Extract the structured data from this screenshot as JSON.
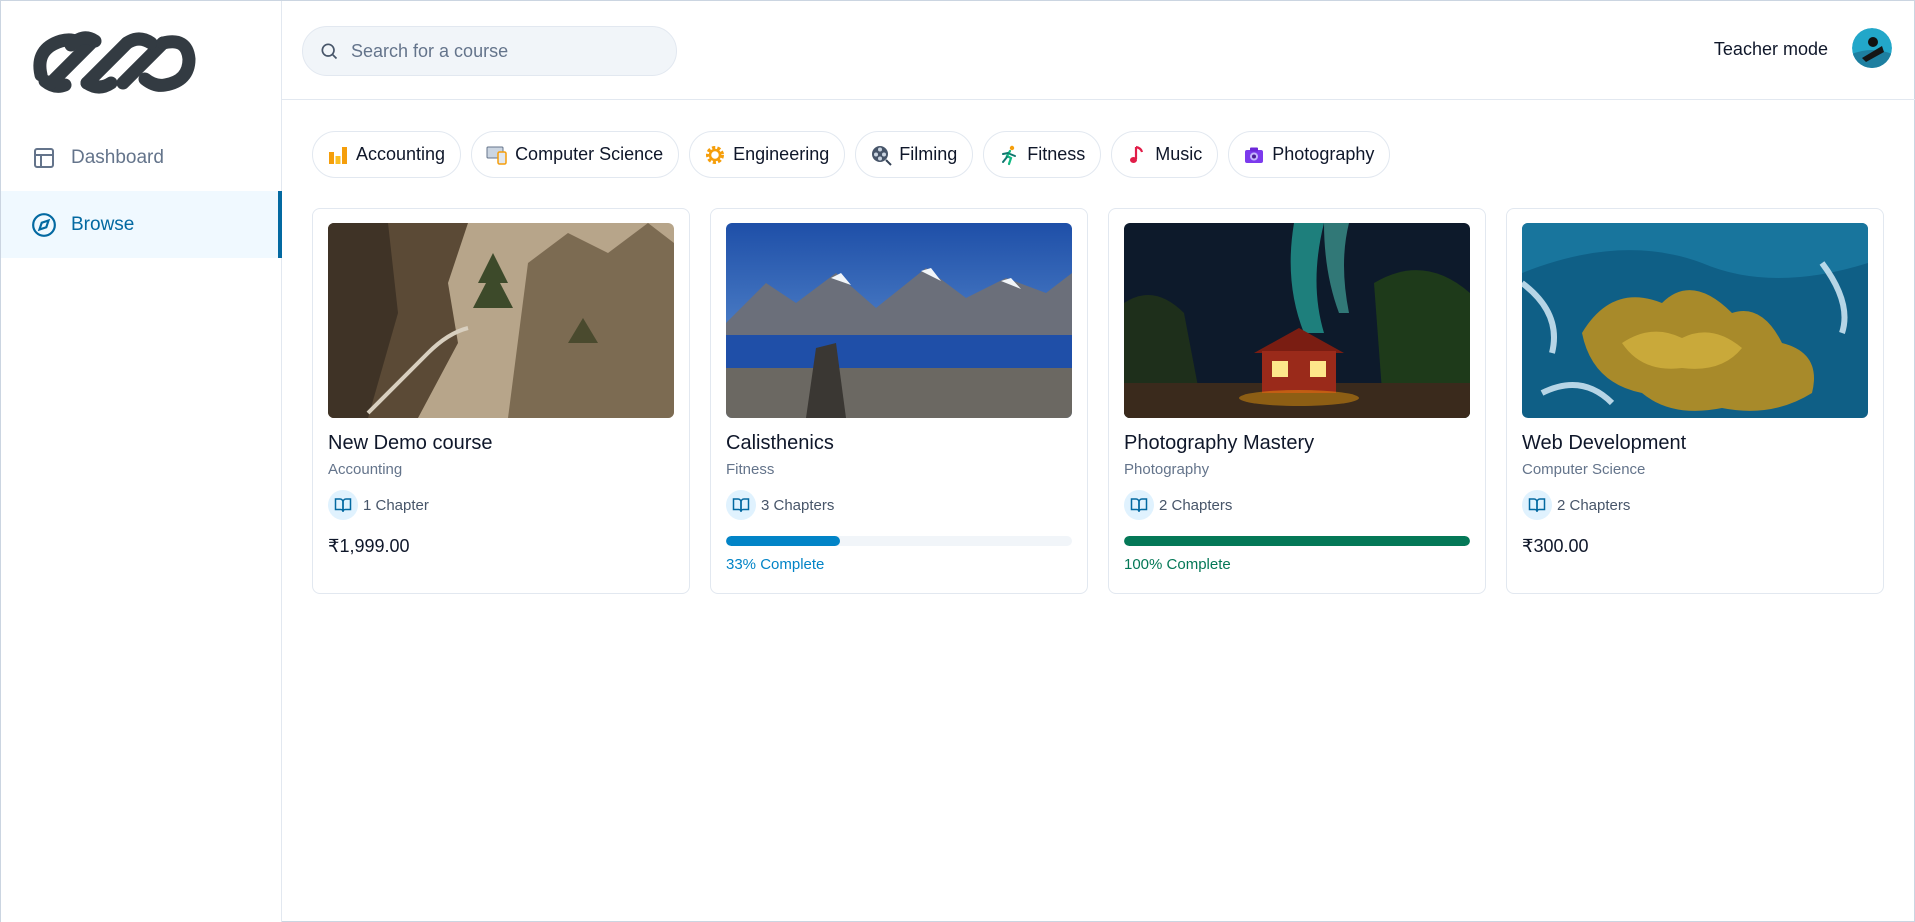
{
  "sidebar": {
    "items": [
      {
        "label": "Dashboard",
        "icon": "layout-icon"
      },
      {
        "label": "Browse",
        "icon": "compass-icon"
      }
    ]
  },
  "header": {
    "search_placeholder": "Search for a course",
    "teacher_mode": "Teacher mode"
  },
  "categories": [
    {
      "label": "Accounting",
      "icon": "bar-chart-icon"
    },
    {
      "label": "Computer Science",
      "icon": "computer-icon"
    },
    {
      "label": "Engineering",
      "icon": "gear-icon"
    },
    {
      "label": "Filming",
      "icon": "film-reel-icon"
    },
    {
      "label": "Fitness",
      "icon": "running-icon"
    },
    {
      "label": "Music",
      "icon": "music-note-icon"
    },
    {
      "label": "Photography",
      "icon": "camera-icon"
    }
  ],
  "courses": [
    {
      "title": "New Demo course",
      "category": "Accounting",
      "chapters": "1 Chapter",
      "price": "₹1,999.00",
      "image": "mountain-cliff-path"
    },
    {
      "title": "Calisthenics",
      "category": "Fitness",
      "chapters": "3 Chapters",
      "progress": 0.33,
      "progress_text": "33% Complete",
      "image": "mountain-lake"
    },
    {
      "title": "Photography Mastery",
      "category": "Photography",
      "chapters": "2 Chapters",
      "progress": 1.0,
      "progress_text": "100% Complete",
      "image": "aurora-cabin"
    },
    {
      "title": "Web Development",
      "category": "Computer Science",
      "chapters": "2 Chapters",
      "price": "₹300.00",
      "image": "ocean-rocks"
    }
  ],
  "colors": {
    "accent": "#0369a1",
    "progress_partial": "#0284c7",
    "progress_complete": "#047857"
  }
}
